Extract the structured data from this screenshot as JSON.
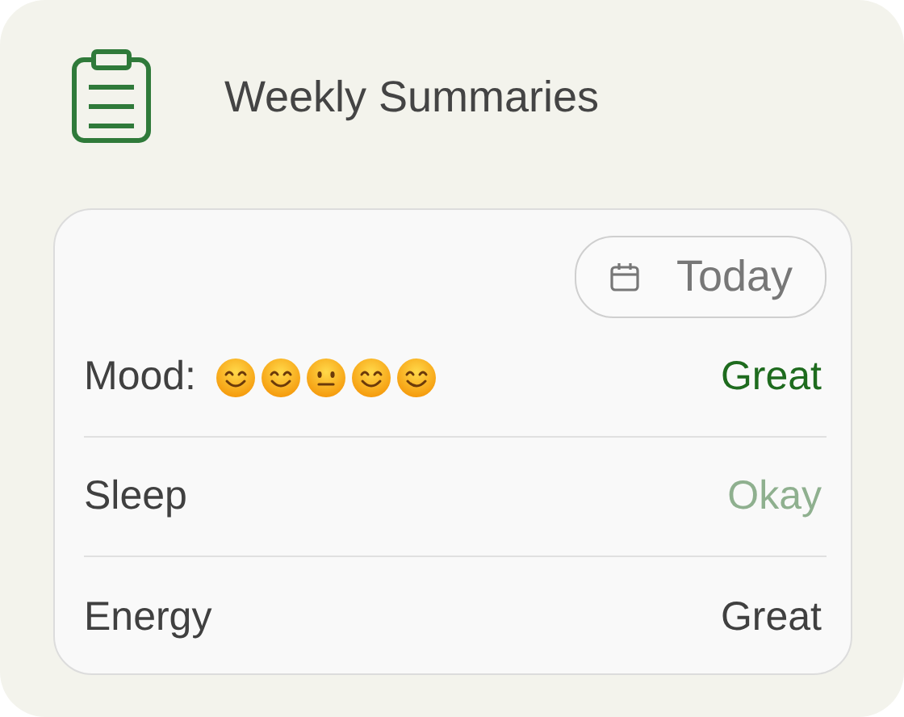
{
  "title": "Weekly Summaries",
  "date_button": {
    "label": "Today"
  },
  "rows": [
    {
      "label": "Mood:",
      "faces": [
        {
          "kind": "smile"
        },
        {
          "kind": "smile"
        },
        {
          "kind": "neutral"
        },
        {
          "kind": "smile"
        },
        {
          "kind": "smile"
        }
      ],
      "value": "Great",
      "color": "#1e6b1e"
    },
    {
      "label": "Sleep",
      "value": "Okay",
      "color": "#8fb08f"
    },
    {
      "label": "Energy",
      "value": "Great",
      "color": "#404040"
    }
  ]
}
